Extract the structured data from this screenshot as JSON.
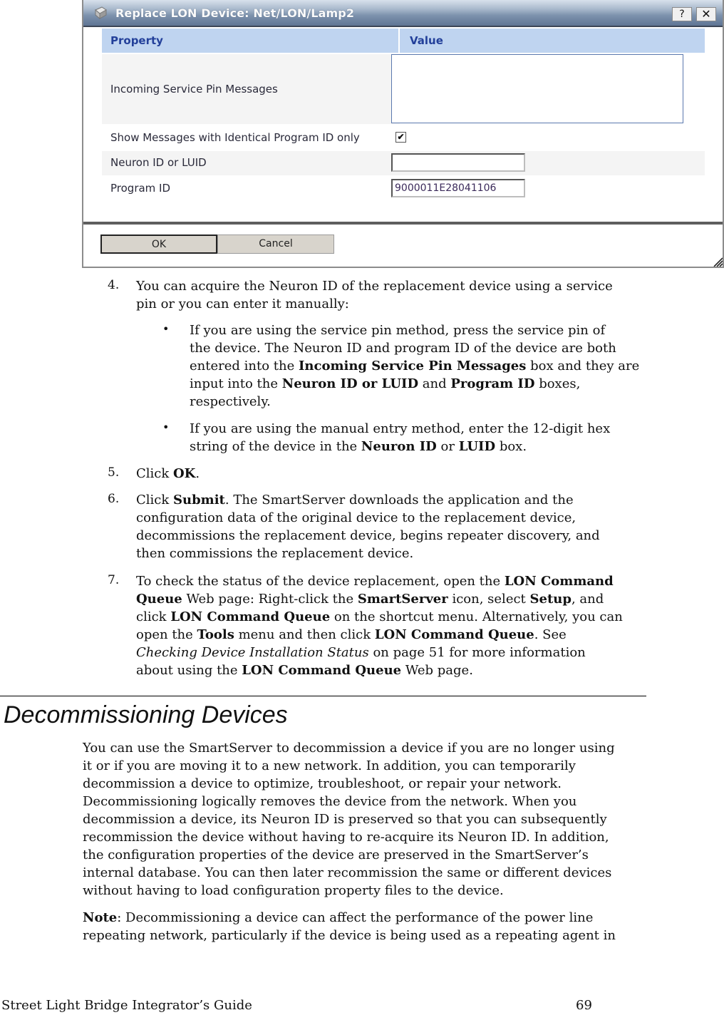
{
  "dialog": {
    "title": "Replace LON Device: Net/LON/Lamp2",
    "help_label": "?",
    "close_label": "✕",
    "icon": "device-icon",
    "table": {
      "headers": [
        "Property",
        "Value"
      ],
      "rows": [
        {
          "label": "Incoming Service Pin Messages",
          "type": "textarea",
          "value": ""
        },
        {
          "label": "Show Messages with Identical Program ID only",
          "type": "checkbox",
          "checked": true,
          "check_glyph": "✔"
        },
        {
          "label": "Neuron ID or LUID",
          "type": "text",
          "value": ""
        },
        {
          "label": "Program ID",
          "type": "text",
          "value": "9000011E28041106"
        }
      ]
    },
    "buttons": {
      "ok": "OK",
      "cancel": "Cancel"
    }
  },
  "steps": [
    {
      "num": "4.",
      "lines": [
        "You can acquire the Neuron ID of the replacement device using a service",
        "pin or you can enter it manually:"
      ]
    },
    {
      "num": "5.",
      "pre": "Click ",
      "bold": "OK",
      "post": "."
    },
    {
      "num": "6.",
      "lines": [
        "configuration data of the original device to the replacement device,",
        "decommissions the replacement device, begins repeater discovery, and",
        "then commissions the replacement device."
      ],
      "first_pre": "Click ",
      "first_bold": "Submit",
      "first_post": ".  The SmartServer downloads the application and the"
    },
    {
      "num": "7."
    }
  ],
  "bullets": [
    {
      "glyph": "•"
    },
    {
      "glyph": "•"
    }
  ],
  "text": {
    "b1_l1": "If you are using the service pin method, press the service pin of",
    "b1_l2": "the device.  The Neuron ID and program ID of the device are both",
    "b1_l3_pre": "entered into the ",
    "b1_l3_bold": "Incoming Service Pin Messages",
    "b1_l3_post": " box and they are",
    "b1_l4_pre": "input into the ",
    "b1_l4_bold1": "Neuron ID or LUID",
    "b1_l4_mid": " and ",
    "b1_l4_bold2": "Program ID",
    "b1_l4_post": " boxes,",
    "b1_l5": "respectively.",
    "b2_l1": "If you are using the manual entry method, enter the 12-digit hex",
    "b2_l2_pre": "string of the device in the ",
    "b2_l2_bold1": "Neuron ID",
    "b2_l2_mid": " or ",
    "b2_l2_bold2": "LUID",
    "b2_l2_post": " box.",
    "s7_l1_pre": "To check the status of the device replacement, open the ",
    "s7_l1_bold": "LON Command",
    "s7_l2_bold": "Queue",
    "s7_l2_mid": " Web page:  Right-click the ",
    "s7_l2_bold2": "SmartServer",
    "s7_l2_mid2": " icon, select ",
    "s7_l2_bold3": "Setup",
    "s7_l2_post": ", and",
    "s7_l3_pre": "click ",
    "s7_l3_bold": "LON Command Queue",
    "s7_l3_post": " on the shortcut menu.  Alternatively, you can",
    "s7_l4_pre": "open the ",
    "s7_l4_bold": "Tools",
    "s7_l4_mid": " menu and then click ",
    "s7_l4_bold2": "LON Command Queue",
    "s7_l4_post": ".  See",
    "s7_l5_ital": "Checking Device Installation Status",
    "s7_l5_post": " on page 51 for more information",
    "s7_l6_pre": "about using the ",
    "s7_l6_bold": "LON Command Queue",
    "s7_l6_post": " Web page."
  },
  "section": {
    "heading": "Decommissioning Devices",
    "paragraph": [
      "You can use the SmartServer to decommission a device if you are no longer using",
      "it or if you are moving it to a new network.  In addition, you can temporarily",
      "decommission a device to optimize, troubleshoot, or repair your network.",
      "Decommissioning logically removes the device from the network.  When you",
      "decommission a device, its Neuron ID is preserved so that you can subsequently",
      "recommission the device without having to re-acquire its Neuron ID.  In addition,",
      "the configuration properties of the device are preserved in the SmartServer’s",
      "internal database.  You can then later recommission the same or different devices",
      "without having to load configuration property files to the device."
    ],
    "note_label": "Note",
    "note_l1": ":  Decommissioning a device can affect the performance of the power line",
    "note_l2": "repeating network, particularly if the device is being used as a repeating agent in"
  },
  "footer": {
    "title": "Street Light Bridge Integrator’s Guide",
    "page": "69"
  }
}
